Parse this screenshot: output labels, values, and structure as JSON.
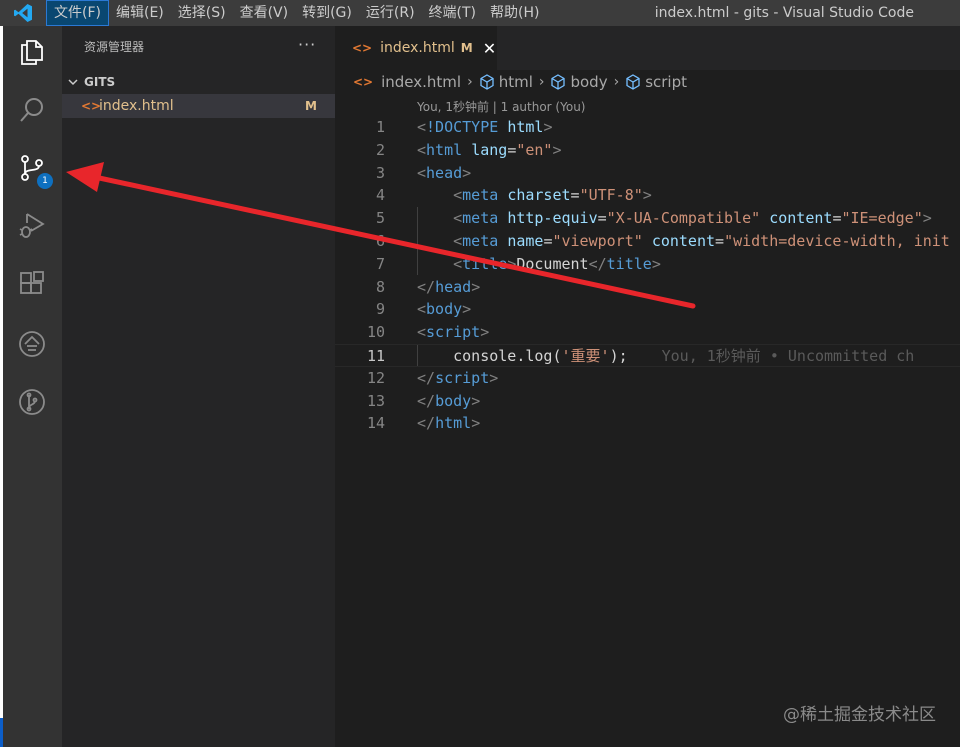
{
  "menubar": {
    "logo_icon": "vscode-logo-icon",
    "items": [
      "文件(F)",
      "编辑(E)",
      "选择(S)",
      "查看(V)",
      "转到(G)",
      "运行(R)",
      "终端(T)",
      "帮助(H)"
    ],
    "window_title": "index.html - gits - Visual Studio Code"
  },
  "activity_bar": {
    "items": [
      {
        "icon": "files-icon"
      },
      {
        "icon": "search-icon"
      },
      {
        "icon": "source-control-icon",
        "badge": "1"
      },
      {
        "icon": "run-debug-icon"
      },
      {
        "icon": "extensions-icon"
      },
      {
        "icon": "remote-explorer-icon"
      },
      {
        "icon": "git-graph-icon"
      }
    ]
  },
  "sidebar": {
    "title": "资源管理器",
    "more_label": "···",
    "section_title": "GITS",
    "files": [
      {
        "icon": "<>",
        "name": "index.html",
        "status": "M"
      }
    ]
  },
  "tab": {
    "icon": "<>",
    "name": "index.html",
    "modified": "M",
    "close": "✕"
  },
  "breadcrumb": [
    "index.html",
    "html",
    "body",
    "script"
  ],
  "blame_header": "You, 1秒钟前 | 1 author (You)",
  "code": {
    "current_line": 11,
    "blame_inline": "You, 1秒钟前 • Uncommitted ch",
    "lines": [
      {
        "n": "1",
        "segs": [
          [
            "t-punc",
            "<"
          ],
          [
            "t-tag",
            "!DOCTYPE "
          ],
          [
            "t-attr",
            "html"
          ],
          [
            "t-punc",
            ">"
          ]
        ]
      },
      {
        "n": "2",
        "segs": [
          [
            "t-punc",
            "<"
          ],
          [
            "t-tag",
            "html "
          ],
          [
            "t-attr",
            "lang"
          ],
          [
            "t-text",
            "="
          ],
          [
            "t-str",
            "\"en\""
          ],
          [
            "t-punc",
            ">"
          ]
        ]
      },
      {
        "n": "3",
        "segs": [
          [
            "t-punc",
            "<"
          ],
          [
            "t-tag",
            "head"
          ],
          [
            "t-punc",
            ">"
          ]
        ]
      },
      {
        "n": "4",
        "segs": [
          [
            "t-text",
            "    "
          ],
          [
            "t-punc",
            "<"
          ],
          [
            "t-tag",
            "meta "
          ],
          [
            "t-attr",
            "charset"
          ],
          [
            "t-text",
            "="
          ],
          [
            "t-str",
            "\"UTF-8\""
          ],
          [
            "t-punc",
            ">"
          ]
        ]
      },
      {
        "n": "5",
        "segs": [
          [
            "t-text",
            "    "
          ],
          [
            "t-punc",
            "<"
          ],
          [
            "t-tag",
            "meta "
          ],
          [
            "t-attr",
            "http-equiv"
          ],
          [
            "t-text",
            "="
          ],
          [
            "t-str",
            "\"X-UA-Compatible\" "
          ],
          [
            "t-attr",
            "content"
          ],
          [
            "t-text",
            "="
          ],
          [
            "t-str",
            "\"IE=edge\""
          ],
          [
            "t-punc",
            ">"
          ]
        ]
      },
      {
        "n": "6",
        "segs": [
          [
            "t-text",
            "    "
          ],
          [
            "t-punc",
            "<"
          ],
          [
            "t-tag",
            "meta "
          ],
          [
            "t-attr",
            "name"
          ],
          [
            "t-text",
            "="
          ],
          [
            "t-str",
            "\"viewport\" "
          ],
          [
            "t-attr",
            "content"
          ],
          [
            "t-text",
            "="
          ],
          [
            "t-str",
            "\"width=device-width, init"
          ]
        ]
      },
      {
        "n": "7",
        "segs": [
          [
            "t-text",
            "    "
          ],
          [
            "t-punc",
            "<"
          ],
          [
            "t-tag",
            "title"
          ],
          [
            "t-punc",
            ">"
          ],
          [
            "t-text",
            "Document"
          ],
          [
            "t-punc",
            "</"
          ],
          [
            "t-tag",
            "title"
          ],
          [
            "t-punc",
            ">"
          ]
        ]
      },
      {
        "n": "8",
        "segs": [
          [
            "t-punc",
            "</"
          ],
          [
            "t-tag",
            "head"
          ],
          [
            "t-punc",
            ">"
          ]
        ]
      },
      {
        "n": "9",
        "segs": [
          [
            "t-punc",
            "<"
          ],
          [
            "t-tag",
            "body"
          ],
          [
            "t-punc",
            ">"
          ]
        ]
      },
      {
        "n": "10",
        "segs": [
          [
            "t-punc",
            "<"
          ],
          [
            "t-tag",
            "script"
          ],
          [
            "t-punc",
            ">"
          ]
        ]
      },
      {
        "n": "11",
        "segs": [
          [
            "t-text",
            "    console.log("
          ],
          [
            "t-str",
            "'重要'"
          ],
          [
            "t-text",
            ");"
          ]
        ]
      },
      {
        "n": "12",
        "segs": [
          [
            "t-punc",
            "</"
          ],
          [
            "t-tag",
            "script"
          ],
          [
            "t-punc",
            ">"
          ]
        ]
      },
      {
        "n": "13",
        "segs": [
          [
            "t-punc",
            "</"
          ],
          [
            "t-tag",
            "body"
          ],
          [
            "t-punc",
            ">"
          ]
        ]
      },
      {
        "n": "14",
        "segs": [
          [
            "t-punc",
            "</"
          ],
          [
            "t-tag",
            "html"
          ],
          [
            "t-punc",
            ">"
          ]
        ]
      }
    ]
  },
  "watermark": "@稀土掘金技术社区",
  "annotation": {
    "color": "#e8262b",
    "description": "red arrow pointing to source control icon"
  }
}
